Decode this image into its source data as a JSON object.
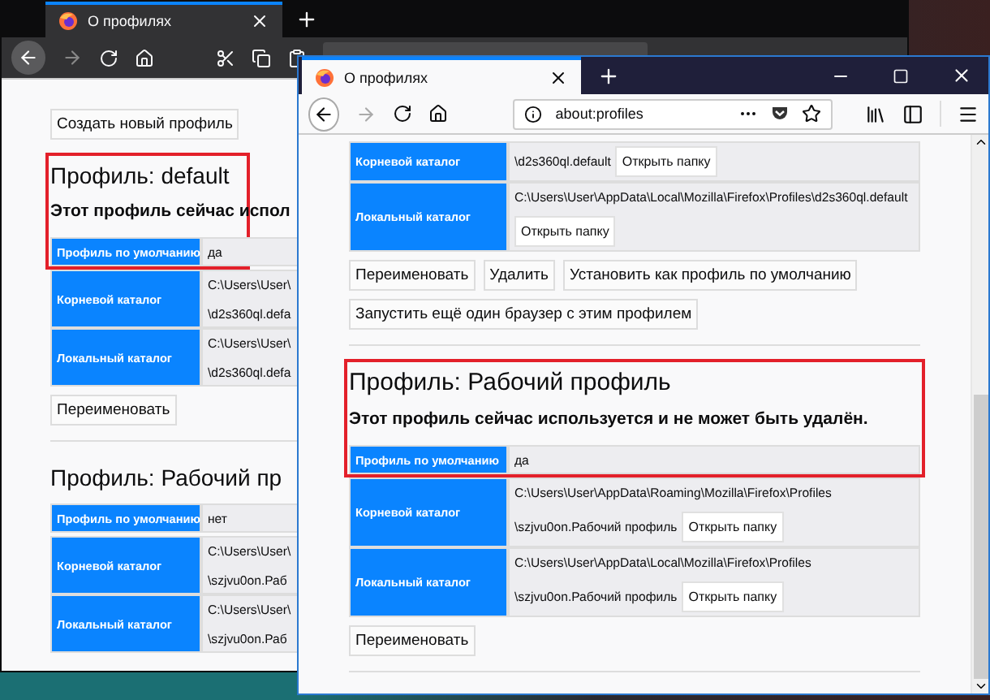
{
  "back_window": {
    "tab": {
      "title": "О профилях",
      "selected": true
    },
    "create_button": "Создать новый профиль",
    "profiles": [
      {
        "heading": "Профиль: default",
        "notice": "Этот профиль сейчас испол",
        "highlighted": true,
        "rows": [
          {
            "label": "Профиль по умолчанию",
            "lines": [
              {
                "text": "да"
              }
            ]
          },
          {
            "label": "Корневой каталог",
            "lines": [
              {
                "text": "C:\\Users\\User\\"
              },
              {
                "text": "\\d2s360ql.defa"
              }
            ]
          },
          {
            "label": "Локальный каталог",
            "lines": [
              {
                "text": "C:\\Users\\User\\"
              },
              {
                "text": "\\d2s360ql.defa"
              }
            ]
          }
        ],
        "buttons": [
          "Переименовать"
        ]
      },
      {
        "heading": "Профиль: Рабочий пр",
        "highlighted": false,
        "rows": [
          {
            "label": "Профиль по умолчанию",
            "lines": [
              {
                "text": "нет"
              }
            ]
          },
          {
            "label": "Корневой каталог",
            "lines": [
              {
                "text": "C:\\Users\\User\\"
              },
              {
                "text": "\\szjvu0on.Раб"
              }
            ]
          },
          {
            "label": "Локальный каталог",
            "lines": [
              {
                "text": "C:\\Users\\User\\"
              },
              {
                "text": "\\szjvu0on.Раб"
              }
            ]
          }
        ]
      }
    ]
  },
  "front_window": {
    "tab": {
      "title": "О профилях",
      "selected": true
    },
    "address": "about:profiles",
    "profiles": [
      {
        "highlighted": false,
        "rows": [
          {
            "label": "Корневой каталог",
            "lines": [
              {
                "text": "\\d2s360ql.default",
                "button": "Открыть папку"
              }
            ]
          },
          {
            "label": "Локальный каталог",
            "lines": [
              {
                "text": "C:\\Users\\User\\AppData\\Local\\Mozilla\\Firefox\\Profiles\\d2s360ql.default"
              },
              {
                "button": "Открыть папку"
              }
            ]
          }
        ],
        "buttons": [
          "Переименовать",
          "Удалить",
          "Установить как профиль по умолчанию",
          "Запустить ещё один браузер с этим профилем"
        ]
      },
      {
        "heading": "Профиль: Рабочий профиль",
        "notice": "Этот профиль сейчас используется и не может быть удалён.",
        "highlighted": true,
        "rows": [
          {
            "label": "Профиль по умолчанию",
            "lines": [
              {
                "text": "да"
              }
            ]
          },
          {
            "label": "Корневой каталог",
            "lines": [
              {
                "text": "C:\\Users\\User\\AppData\\Roaming\\Mozilla\\Firefox\\Profiles"
              },
              {
                "text": "\\szjvu0on.Рабочий профиль",
                "button": "Открыть папку"
              }
            ]
          },
          {
            "label": "Локальный каталог",
            "lines": [
              {
                "text": "C:\\Users\\User\\AppData\\Local\\Mozilla\\Firefox\\Profiles"
              },
              {
                "text": "\\szjvu0on.Рабочий профиль",
                "button": "Открыть папку"
              }
            ]
          }
        ],
        "buttons": [
          "Переименовать"
        ]
      }
    ]
  }
}
